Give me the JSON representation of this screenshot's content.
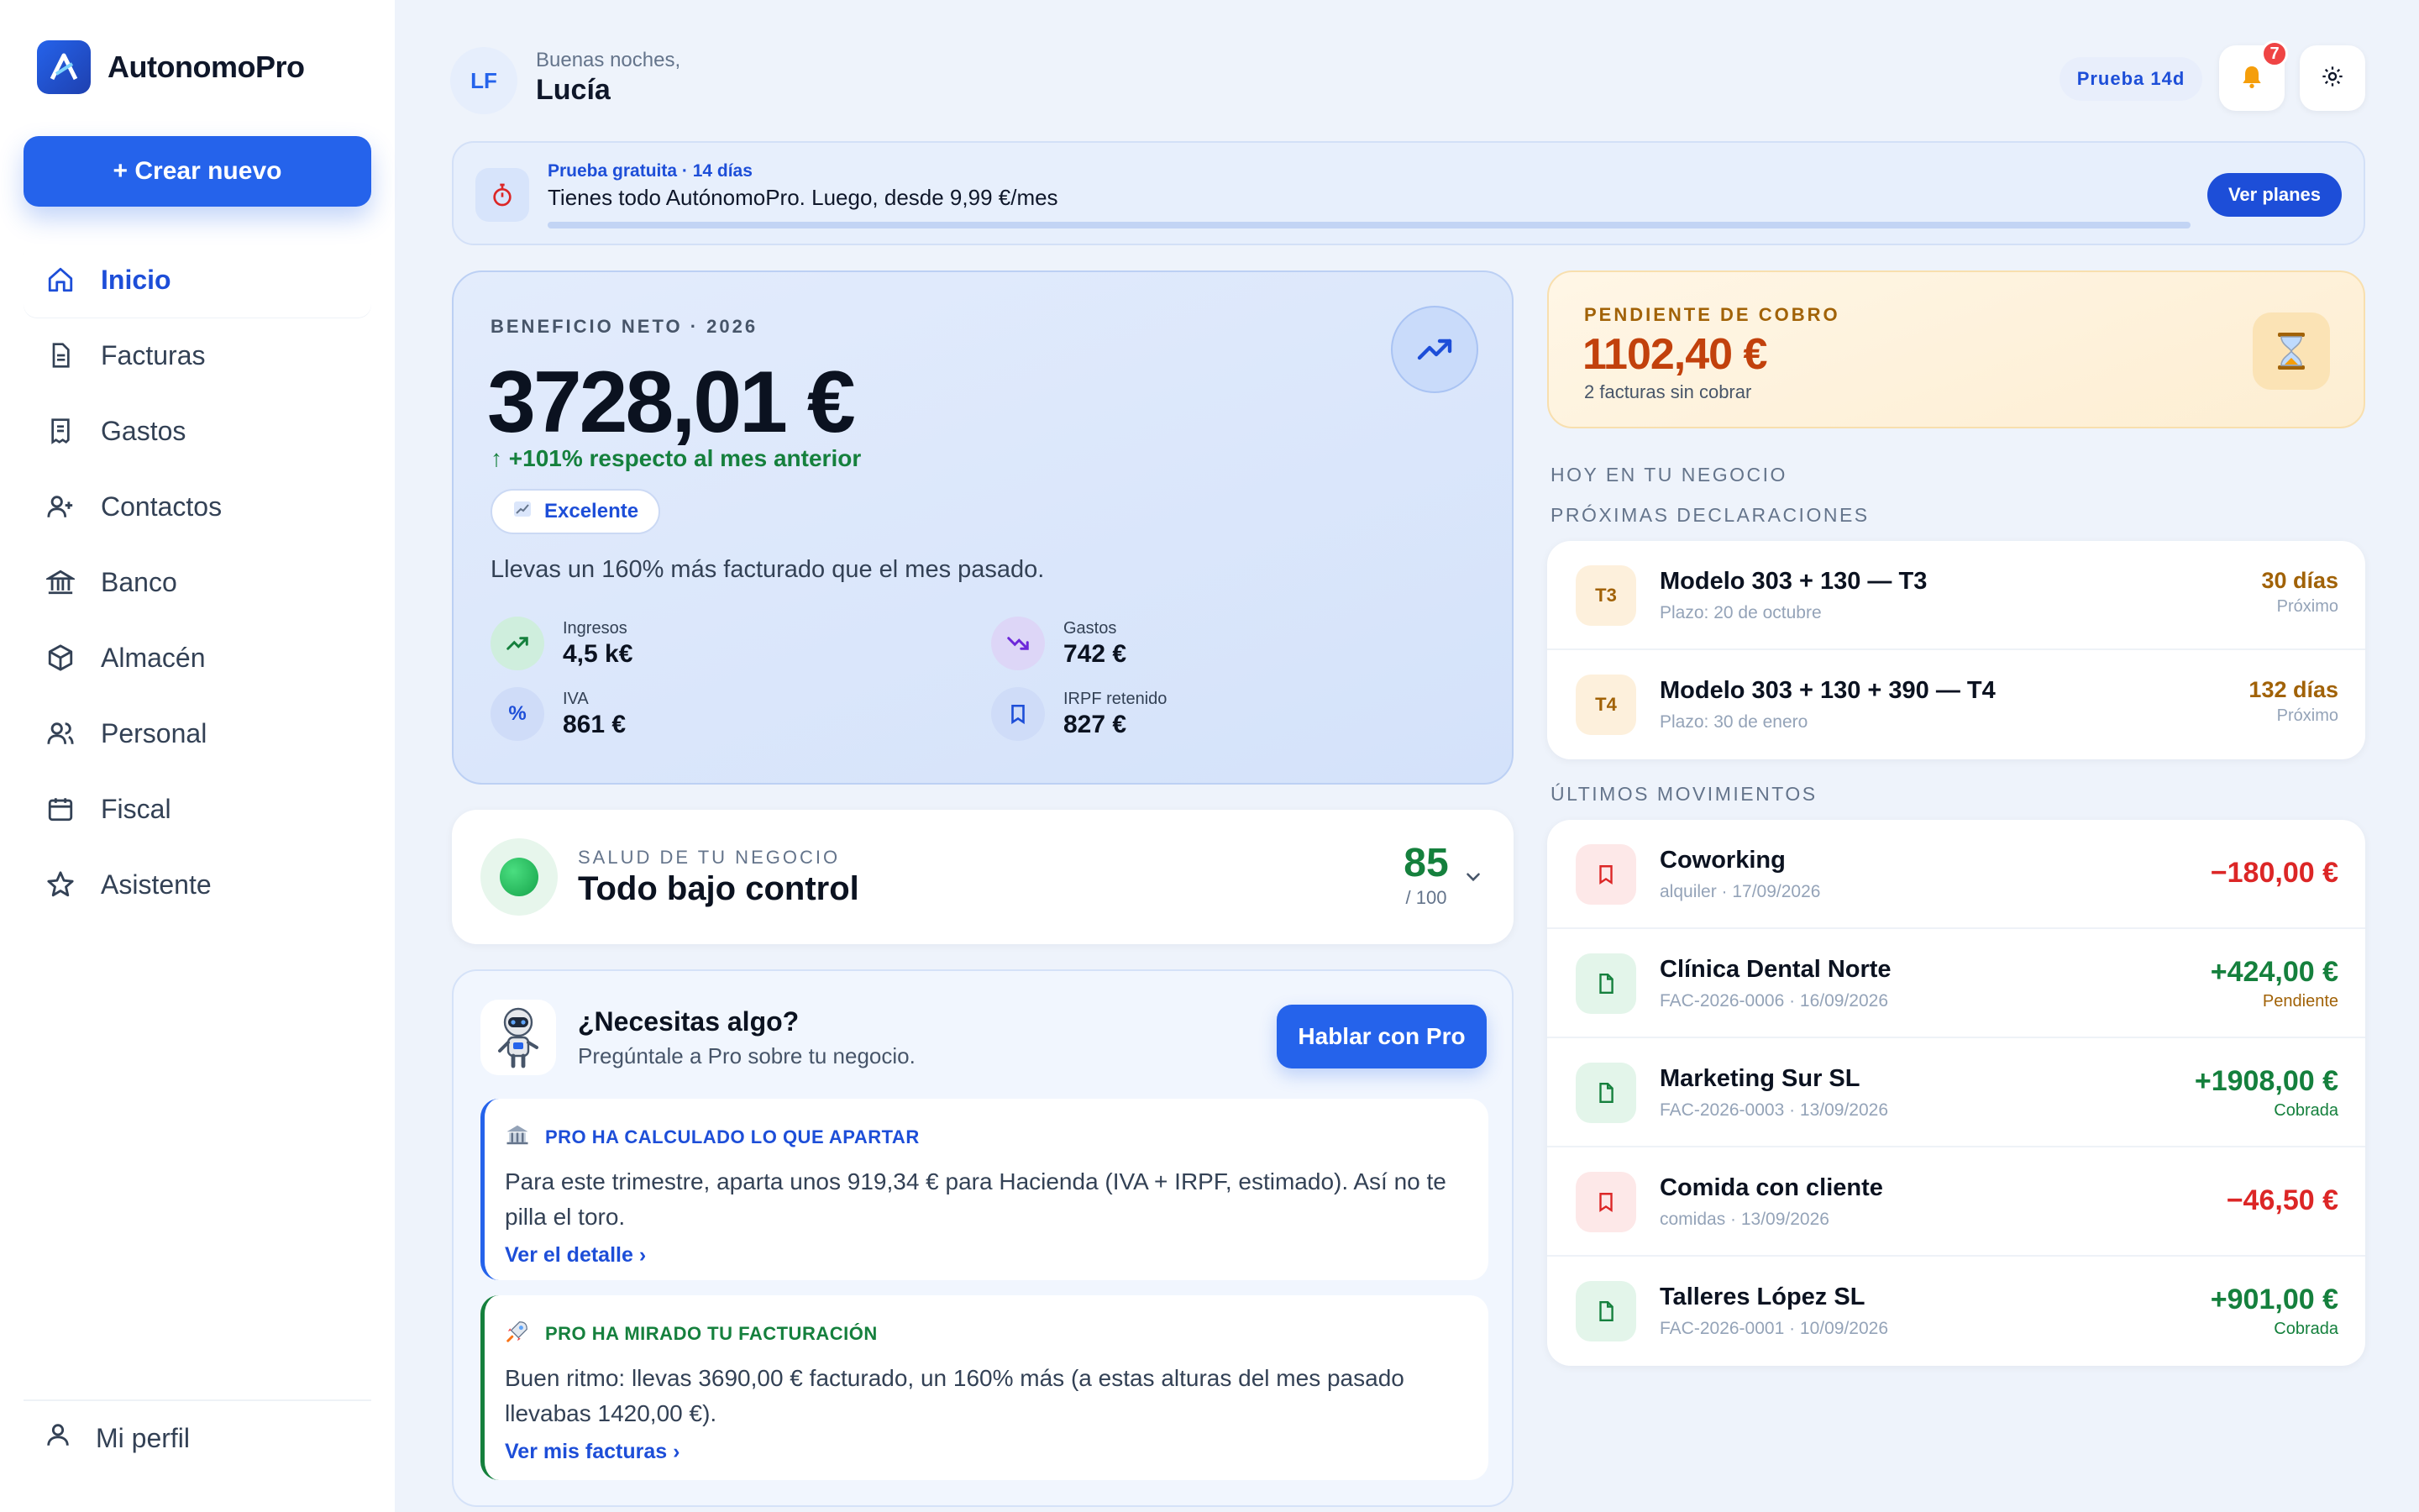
{
  "app": {
    "name": "AutonomoPro"
  },
  "sidebar": {
    "create_label": "+ Crear nuevo",
    "items": [
      {
        "label": "Inicio",
        "icon": "home-icon"
      },
      {
        "label": "Facturas",
        "icon": "document-icon"
      },
      {
        "label": "Gastos",
        "icon": "receipt-icon"
      },
      {
        "label": "Contactos",
        "icon": "user-plus-icon"
      },
      {
        "label": "Banco",
        "icon": "bank-icon"
      },
      {
        "label": "Almacén",
        "icon": "box-icon"
      },
      {
        "label": "Personal",
        "icon": "users-icon"
      },
      {
        "label": "Fiscal",
        "icon": "calendar-icon"
      },
      {
        "label": "Asistente",
        "icon": "star-icon"
      }
    ],
    "profile_label": "Mi perfil"
  },
  "header": {
    "avatar_initials": "LF",
    "greeting": "Buenas noches,",
    "user_name": "Lucía",
    "trial_pill": "Prueba 14d",
    "notifications_count": "7"
  },
  "banner": {
    "subtitle": "Prueba gratuita · 14 días",
    "title": "Tienes todo AutónomoPro. Luego, desde 9,99 €/mes",
    "cta": "Ver planes",
    "progress_percent": 100
  },
  "profit": {
    "eyebrow": "BENEFICIO NETO · 2026",
    "value": "3728,01 €",
    "change": "+101% respecto al mes anterior",
    "chip": "Excelente",
    "description": "Llevas un 160% más facturado que el mes pasado.",
    "metrics": [
      {
        "label": "Ingresos",
        "value": "4,5 k€"
      },
      {
        "label": "Gastos",
        "value": "742 €"
      },
      {
        "label": "IVA",
        "value": "861 €"
      },
      {
        "label": "IRPF retenido",
        "value": "827 €"
      }
    ]
  },
  "health": {
    "eyebrow": "SALUD DE TU NEGOCIO",
    "title": "Todo bajo control",
    "score": "85",
    "max": "/ 100"
  },
  "assistant": {
    "title": "¿Necesitas algo?",
    "subtitle": "Pregúntale a Pro sobre tu negocio.",
    "cta": "Hablar con Pro",
    "tips": [
      {
        "head": "PRO HA CALCULADO LO QUE APARTAR",
        "text": "Para este trimestre, aparta unos 919,34 € para Hacienda (IVA + IRPF, estimado). Así no te pilla el toro.",
        "link": "Ver el detalle ›",
        "accent": "#2563eb"
      },
      {
        "head": "PRO HA MIRADO TU FACTURACIÓN",
        "text": "Buen ritmo: llevas 3690,00 € facturado, un 160% más (a estas alturas del mes pasado llevabas 1420,00 €).",
        "link": "Ver mis facturas ›",
        "accent": "#15803d"
      }
    ]
  },
  "pending": {
    "eyebrow": "PENDIENTE DE COBRO",
    "value": "1102,40 €",
    "subtitle": "2 facturas sin cobrar"
  },
  "today_label": "HOY EN TU NEGOCIO",
  "declarations": {
    "label": "PRÓXIMAS DECLARACIONES",
    "items": [
      {
        "badge": "T3",
        "title": "Modelo 303 + 130 — T3",
        "subtitle": "Plazo: 20 de octubre",
        "days": "30 días",
        "note": "Próximo"
      },
      {
        "badge": "T4",
        "title": "Modelo 303 + 130 + 390 — T4",
        "subtitle": "Plazo: 30 de enero",
        "days": "132 días",
        "note": "Próximo"
      }
    ]
  },
  "movements": {
    "label": "ÚLTIMOS MOVIMIENTOS",
    "items": [
      {
        "title": "Coworking",
        "subtitle": "alquiler · 17/09/2026",
        "amount": "−180,00 €",
        "status": "",
        "kind": "expense"
      },
      {
        "title": "Clínica Dental Norte",
        "subtitle": "FAC-2026-0006 · 16/09/2026",
        "amount": "+424,00 €",
        "status": "Pendiente",
        "kind": "income"
      },
      {
        "title": "Marketing Sur SL",
        "subtitle": "FAC-2026-0003 · 13/09/2026",
        "amount": "+1908,00 €",
        "status": "Cobrada",
        "kind": "income"
      },
      {
        "title": "Comida con cliente",
        "subtitle": "comidas · 13/09/2026",
        "amount": "−46,50 €",
        "status": "",
        "kind": "expense"
      },
      {
        "title": "Talleres López SL",
        "subtitle": "FAC-2026-0001 · 10/09/2026",
        "amount": "+901,00 €",
        "status": "Cobrada",
        "kind": "income"
      }
    ]
  },
  "colors": {
    "accent": "#2563eb",
    "positive": "#15803d",
    "negative": "#dc2626",
    "warning": "#a16207"
  }
}
